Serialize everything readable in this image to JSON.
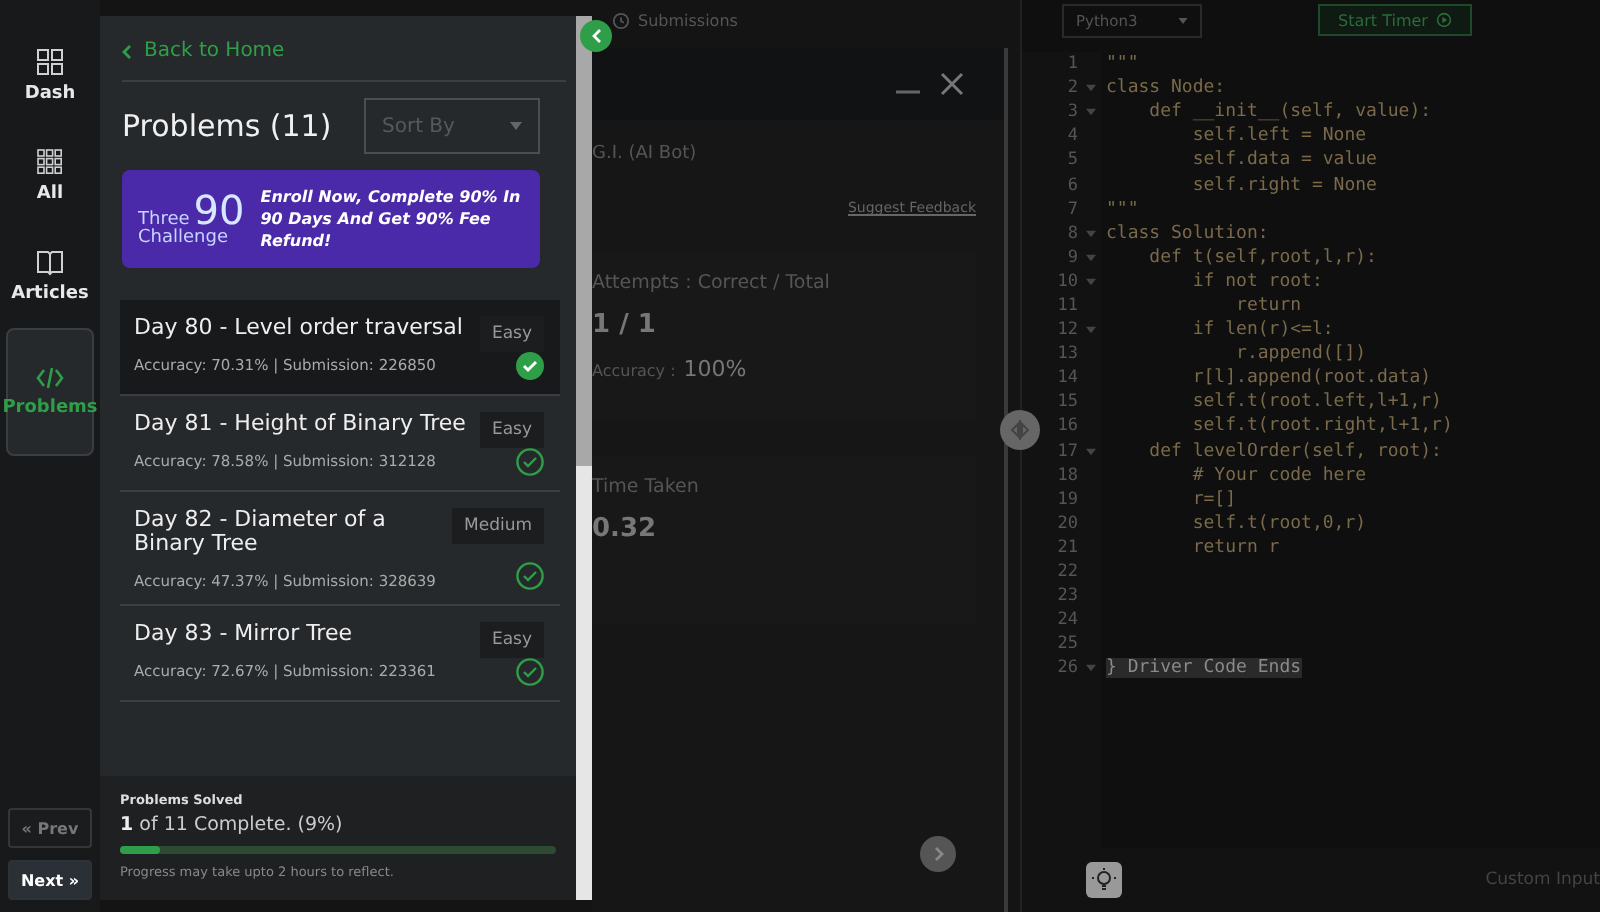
{
  "rail": {
    "items": [
      {
        "label": "Dash",
        "selected": false
      },
      {
        "label": "All",
        "selected": false
      },
      {
        "label": "Articles",
        "selected": false
      },
      {
        "label": "Problems",
        "selected": true
      }
    ],
    "prev": "« Prev",
    "next": "Next »"
  },
  "drawer": {
    "back": "Back to Home",
    "title": "Problems (11)",
    "sort": {
      "placeholder": "Sort By"
    },
    "banner": {
      "logo_top": "Three",
      "logo_num": "90",
      "logo_bottom": "Challenge",
      "text": "Enroll Now, Complete 90% In 90 Days And Get 90% Fee Refund!"
    },
    "problems": [
      {
        "title": "Day 80 - Level order traversal",
        "difficulty": "Easy",
        "stats": "Accuracy: 70.31% | Submission: 226850",
        "solved": true,
        "selected": true
      },
      {
        "title": "Day 81 - Height of Binary Tree",
        "difficulty": "Easy",
        "stats": "Accuracy: 78.58% | Submission: 312128",
        "solved": false,
        "selected": false
      },
      {
        "title": "Day 82 - Diameter of a Binary Tree",
        "difficulty": "Medium",
        "stats": "Accuracy: 47.37% | Submission: 328639",
        "solved": false,
        "selected": false
      },
      {
        "title": "Day 83 - Mirror Tree",
        "difficulty": "Easy",
        "stats": "Accuracy: 72.67% | Submission: 223361",
        "solved": false,
        "selected": false
      }
    ],
    "progress": {
      "label": "Problems Solved",
      "count": "1",
      "rest": "of 11 Complete. (9%)",
      "level": 0.09,
      "note": "Progress may take upto 2 hours to reflect."
    }
  },
  "middle": {
    "tab": "Submissions",
    "bot": "G.I. (AI Bot)",
    "feedback": "Suggest Feedback",
    "cards": [
      {
        "label": "Attempts : Correct / Total",
        "value": "1 / 1",
        "sub_label": "Accuracy :",
        "sub_value": "100%"
      },
      {
        "label": "Time Taken",
        "value": "0.32"
      }
    ]
  },
  "editor": {
    "language": "Python3",
    "timer": "Start Timer",
    "footer": "Custom Input",
    "lines": [
      {
        "num": "1",
        "text": "\"\"\"",
        "fold": false,
        "highlighted": false
      },
      {
        "num": "2",
        "text": "class Node:",
        "fold": true,
        "highlighted": false
      },
      {
        "num": "3",
        "text": "    def __init__(self, value):",
        "fold": true,
        "highlighted": false
      },
      {
        "num": "4",
        "text": "        self.left = None",
        "fold": false,
        "highlighted": false
      },
      {
        "num": "5",
        "text": "        self.data = value",
        "fold": false,
        "highlighted": false
      },
      {
        "num": "6",
        "text": "        self.right = None",
        "fold": false,
        "highlighted": false
      },
      {
        "num": "7",
        "text": "\"\"\"",
        "fold": false,
        "highlighted": false
      },
      {
        "num": "8",
        "text": "class Solution:",
        "fold": true,
        "highlighted": false
      },
      {
        "num": "9",
        "text": "    def t(self,root,l,r):",
        "fold": true,
        "highlighted": false
      },
      {
        "num": "10",
        "text": "        if not root:",
        "fold": true,
        "highlighted": false
      },
      {
        "num": "11",
        "text": "            return",
        "fold": false,
        "highlighted": false
      },
      {
        "num": "12",
        "text": "        if len(r)<=l:",
        "fold": true,
        "highlighted": false
      },
      {
        "num": "13",
        "text": "            r.append([])",
        "fold": false,
        "highlighted": false
      },
      {
        "num": "14",
        "text": "        r[l].append(root.data)",
        "fold": false,
        "highlighted": false
      },
      {
        "num": "15",
        "text": "        self.t(root.left,l+1,r)",
        "fold": false,
        "highlighted": false
      },
      {
        "num": "16",
        "text": "        self.t(root.right,l+1,r)",
        "fold": false,
        "highlighted": false
      },
      {
        "num": "17",
        "text": "    def levelOrder(self, root):",
        "fold": true,
        "highlighted": false
      },
      {
        "num": "18",
        "text": "        # Your code here",
        "fold": false,
        "highlighted": false
      },
      {
        "num": "19",
        "text": "        r=[]",
        "fold": false,
        "highlighted": false
      },
      {
        "num": "20",
        "text": "        self.t(root,0,r)",
        "fold": false,
        "highlighted": false
      },
      {
        "num": "21",
        "text": "        return r",
        "fold": false,
        "highlighted": false
      },
      {
        "num": "22",
        "fold": false,
        "highlighted": false
      },
      {
        "num": "23",
        "fold": false,
        "highlighted": false
      },
      {
        "num": "24",
        "fold": false,
        "highlighted": false
      },
      {
        "num": "25",
        "fold": false,
        "highlighted": false
      },
      {
        "num": "26",
        "text": "} Driver Code Ends",
        "fold": true,
        "highlighted": true
      }
    ]
  }
}
